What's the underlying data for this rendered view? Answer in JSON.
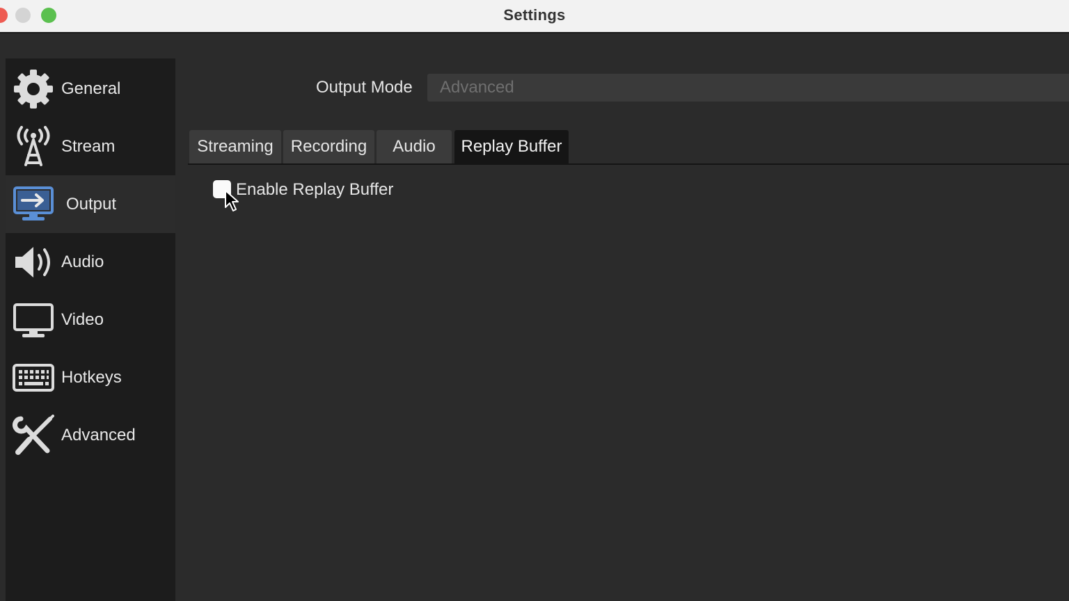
{
  "window": {
    "title": "Settings"
  },
  "sidebar": {
    "items": [
      {
        "label": "General",
        "icon": "gear-icon"
      },
      {
        "label": "Stream",
        "icon": "broadcast-tower-icon"
      },
      {
        "label": "Output",
        "icon": "monitor-output-icon",
        "active": true
      },
      {
        "label": "Audio",
        "icon": "speaker-icon"
      },
      {
        "label": "Video",
        "icon": "monitor-icon"
      },
      {
        "label": "Hotkeys",
        "icon": "keyboard-icon"
      },
      {
        "label": "Advanced",
        "icon": "wrench-screwdriver-icon"
      }
    ]
  },
  "output_mode": {
    "label": "Output Mode",
    "value": "Advanced"
  },
  "tabs": [
    {
      "label": "Streaming"
    },
    {
      "label": "Recording"
    },
    {
      "label": "Audio"
    },
    {
      "label": "Replay Buffer",
      "active": true
    }
  ],
  "replay_buffer": {
    "enable_label": "Enable Replay Buffer",
    "checked": false
  },
  "colors": {
    "accent": "#5a8fd6",
    "background": "#2b2b2b",
    "sidebar": "#1c1c1c"
  }
}
